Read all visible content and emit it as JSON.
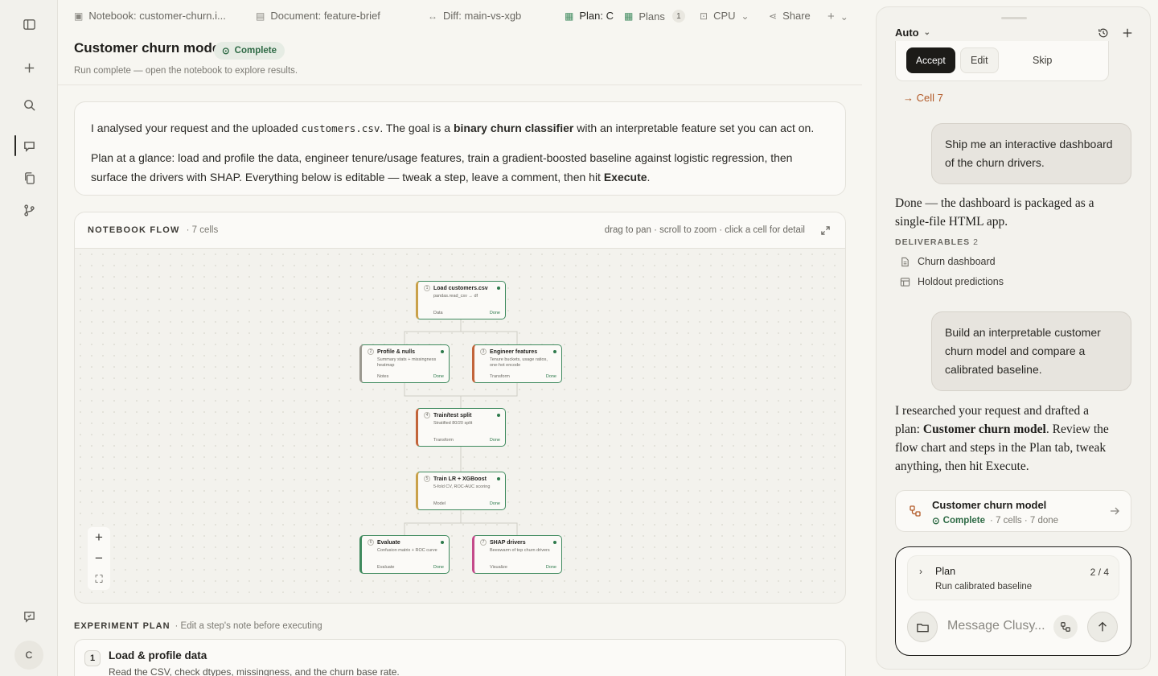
{
  "rail": {
    "avatar_initial": "C"
  },
  "tabs": [
    {
      "icon": "notebook-icon",
      "label": "Notebook: customer-churn.i..."
    },
    {
      "icon": "document-icon",
      "label": "Document: feature-brief"
    },
    {
      "icon": "diff-icon",
      "label": "Diff: main-vs-xgb"
    },
    {
      "icon": "plan-icon",
      "label": "Plan: C"
    },
    {
      "icon": "plans-icon",
      "label": "Plans",
      "count": "1"
    },
    {
      "icon": "cpu-icon",
      "label": "CPU"
    },
    {
      "icon": "share-icon",
      "label": "Share"
    }
  ],
  "header": {
    "title": "Customer churn model",
    "status": "Complete",
    "subtitle": "Run complete — open the notebook to explore results."
  },
  "summary": {
    "p1_pre": "I analysed your request and the uploaded ",
    "p1_code": "customers.csv",
    "p1_mid": ". The goal is a ",
    "p1_bold": "binary churn classifier",
    "p1_post": " with an interpretable feature set you can act on.",
    "p2_pre": "Plan at a glance: load and profile the data, engineer tenure/usage features, train a gradient-boosted baseline against logistic regression, then surface the drivers with SHAP. Everything below is editable — tweak a step, leave a comment, then hit ",
    "p2_bold": "Execute",
    "p2_post": "."
  },
  "flow": {
    "title": "NOTEBOOK FLOW",
    "count": "· 7 cells",
    "hint": "drag to pan · scroll to zoom · click a cell for detail",
    "nodes": [
      {
        "num": "1",
        "title": "Load customers.csv",
        "desc": "pandas.read_csv → df",
        "kind": "Data",
        "status": "Done",
        "accent": "#c9a14a"
      },
      {
        "num": "2",
        "title": "Profile & nulls",
        "desc": "Summary stats + missingness heatmap",
        "kind": "Notes",
        "status": "Done",
        "accent": "#9b9990"
      },
      {
        "num": "3",
        "title": "Engineer features",
        "desc": "Tenure buckets, usage ratios, one-hot encode",
        "kind": "Transform",
        "status": "Done",
        "accent": "#c2643a"
      },
      {
        "num": "4",
        "title": "Train/test split",
        "desc": "Stratified 80/20 split",
        "kind": "Transform",
        "status": "Done",
        "accent": "#c2643a"
      },
      {
        "num": "5",
        "title": "Train LR + XGBoost",
        "desc": "5-fold CV, ROC-AUC scoring",
        "kind": "Model",
        "status": "Done",
        "accent": "#c9a14a"
      },
      {
        "num": "6",
        "title": "Evaluate",
        "desc": "Confusion matrix + ROC curve",
        "kind": "Evaluate",
        "status": "Done",
        "accent": "#3f8a5e"
      },
      {
        "num": "7",
        "title": "SHAP drivers",
        "desc": "Beeswarm of top churn drivers",
        "kind": "Visualize",
        "status": "Done",
        "accent": "#c44a8a"
      }
    ]
  },
  "plan": {
    "heading": "EXPERIMENT PLAN",
    "heading_sub": "· Edit a step's note before executing",
    "steps": [
      {
        "num": "1",
        "title": "Load & profile data",
        "desc": "Read the CSV, check dtypes, missingness, and the churn base rate."
      }
    ]
  },
  "panel": {
    "mode": "Auto",
    "accept": "Accept",
    "edit": "Edit",
    "skip": "Skip",
    "cell_link": "→ Cell 7",
    "msg1": "Ship me an interactive dashboard of the churn drivers.",
    "reply1": "Done — the dashboard is packaged as a single-file HTML app.",
    "deliverables_label": "DELIVERABLES",
    "deliverables_count": "2",
    "deliverables": [
      "Churn dashboard",
      "Holdout predictions"
    ],
    "msg2": "Build an interpretable customer churn model and compare a calibrated baseline.",
    "reply2_pre": "I researched your request and drafted a plan: ",
    "reply2_bold": "Customer churn model",
    "reply2_post": ". Review the flow chart and steps in the Plan tab, tweak anything, then hit Execute.",
    "card_title": "Customer churn model",
    "card_status": "Complete",
    "card_meta": "· 7 cells · 7 done",
    "plan_label": "Plan",
    "plan_step": "Run calibrated baseline",
    "plan_progress": "2 / 4",
    "composer_placeholder": "Message Clusy..."
  }
}
